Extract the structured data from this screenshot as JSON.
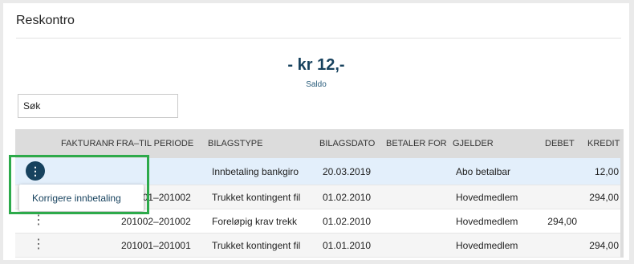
{
  "page": {
    "title": "Reskontro"
  },
  "saldo": {
    "amount": "- kr 12,-",
    "label": "Saldo"
  },
  "search": {
    "value": "Søk"
  },
  "table": {
    "headers": {
      "fakturanr": "FAKTURANR",
      "periode": "FRA–TIL PERIODE",
      "bilagstype": "BILAGSTYPE",
      "bilagsdato": "BILAGSDATO",
      "betaler_for": "BETALER FOR",
      "gjelder": "GJELDER",
      "debet": "DEBET",
      "kredit": "KREDIT"
    },
    "rows": [
      {
        "fakturanr": "",
        "periode": "",
        "bilagstype": "Innbetaling bankgiro",
        "bilagsdato": "20.03.2019",
        "betaler_for": "",
        "gjelder": "Abo betalbar",
        "debet": "",
        "kredit": "12,00"
      },
      {
        "fakturanr": "",
        "periode": "201001–201002",
        "bilagstype": "Trukket kontingent fil",
        "bilagsdato": "01.02.2010",
        "betaler_for": "",
        "gjelder": "Hovedmedlem",
        "debet": "",
        "kredit": "294,00"
      },
      {
        "fakturanr": "",
        "periode": "201002–201002",
        "bilagstype": "Foreløpig krav trekk",
        "bilagsdato": "01.02.2010",
        "betaler_for": "",
        "gjelder": "Hovedmedlem",
        "debet": "294,00",
        "kredit": ""
      },
      {
        "fakturanr": "",
        "periode": "201001–201001",
        "bilagstype": "Trukket kontingent fil",
        "bilagsdato": "01.01.2010",
        "betaler_for": "",
        "gjelder": "Hovedmedlem",
        "debet": "",
        "kredit": "294,00"
      }
    ]
  },
  "context_menu": {
    "item": "Korrigere innbetaling"
  },
  "colors": {
    "accent": "#17425e",
    "highlight": "#2daa4b",
    "selected_row": "#e3effb"
  }
}
